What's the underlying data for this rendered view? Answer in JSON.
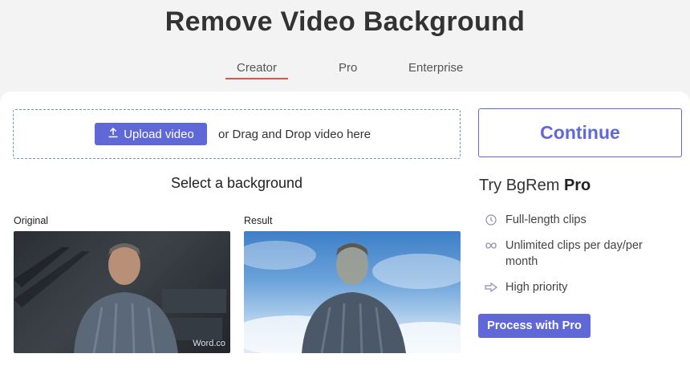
{
  "header": {
    "title": "Remove Video Background"
  },
  "tabs": [
    {
      "label": "Creator",
      "active": true
    },
    {
      "label": "Pro",
      "active": false
    },
    {
      "label": "Enterprise",
      "active": false
    }
  ],
  "upload": {
    "button_label": "Upload video",
    "drag_text": "or Drag and Drop video here"
  },
  "background_section": {
    "heading": "Select a background",
    "original_label": "Original",
    "result_label": "Result",
    "watermark": "Word.co"
  },
  "sidebar": {
    "continue_label": "Continue",
    "try_prefix": "Try BgRem ",
    "try_bold": "Pro",
    "features": [
      {
        "icon": "clock-icon",
        "label": "Full-length clips"
      },
      {
        "icon": "infinity-icon",
        "label": "Unlimited clips per day/per month"
      },
      {
        "icon": "priority-arrow-icon",
        "label": "High priority"
      }
    ],
    "process_label": "Process with Pro"
  },
  "colors": {
    "accent": "#6068d8",
    "tab_underline": "#e05545",
    "page_bg": "#f3f3f4"
  }
}
